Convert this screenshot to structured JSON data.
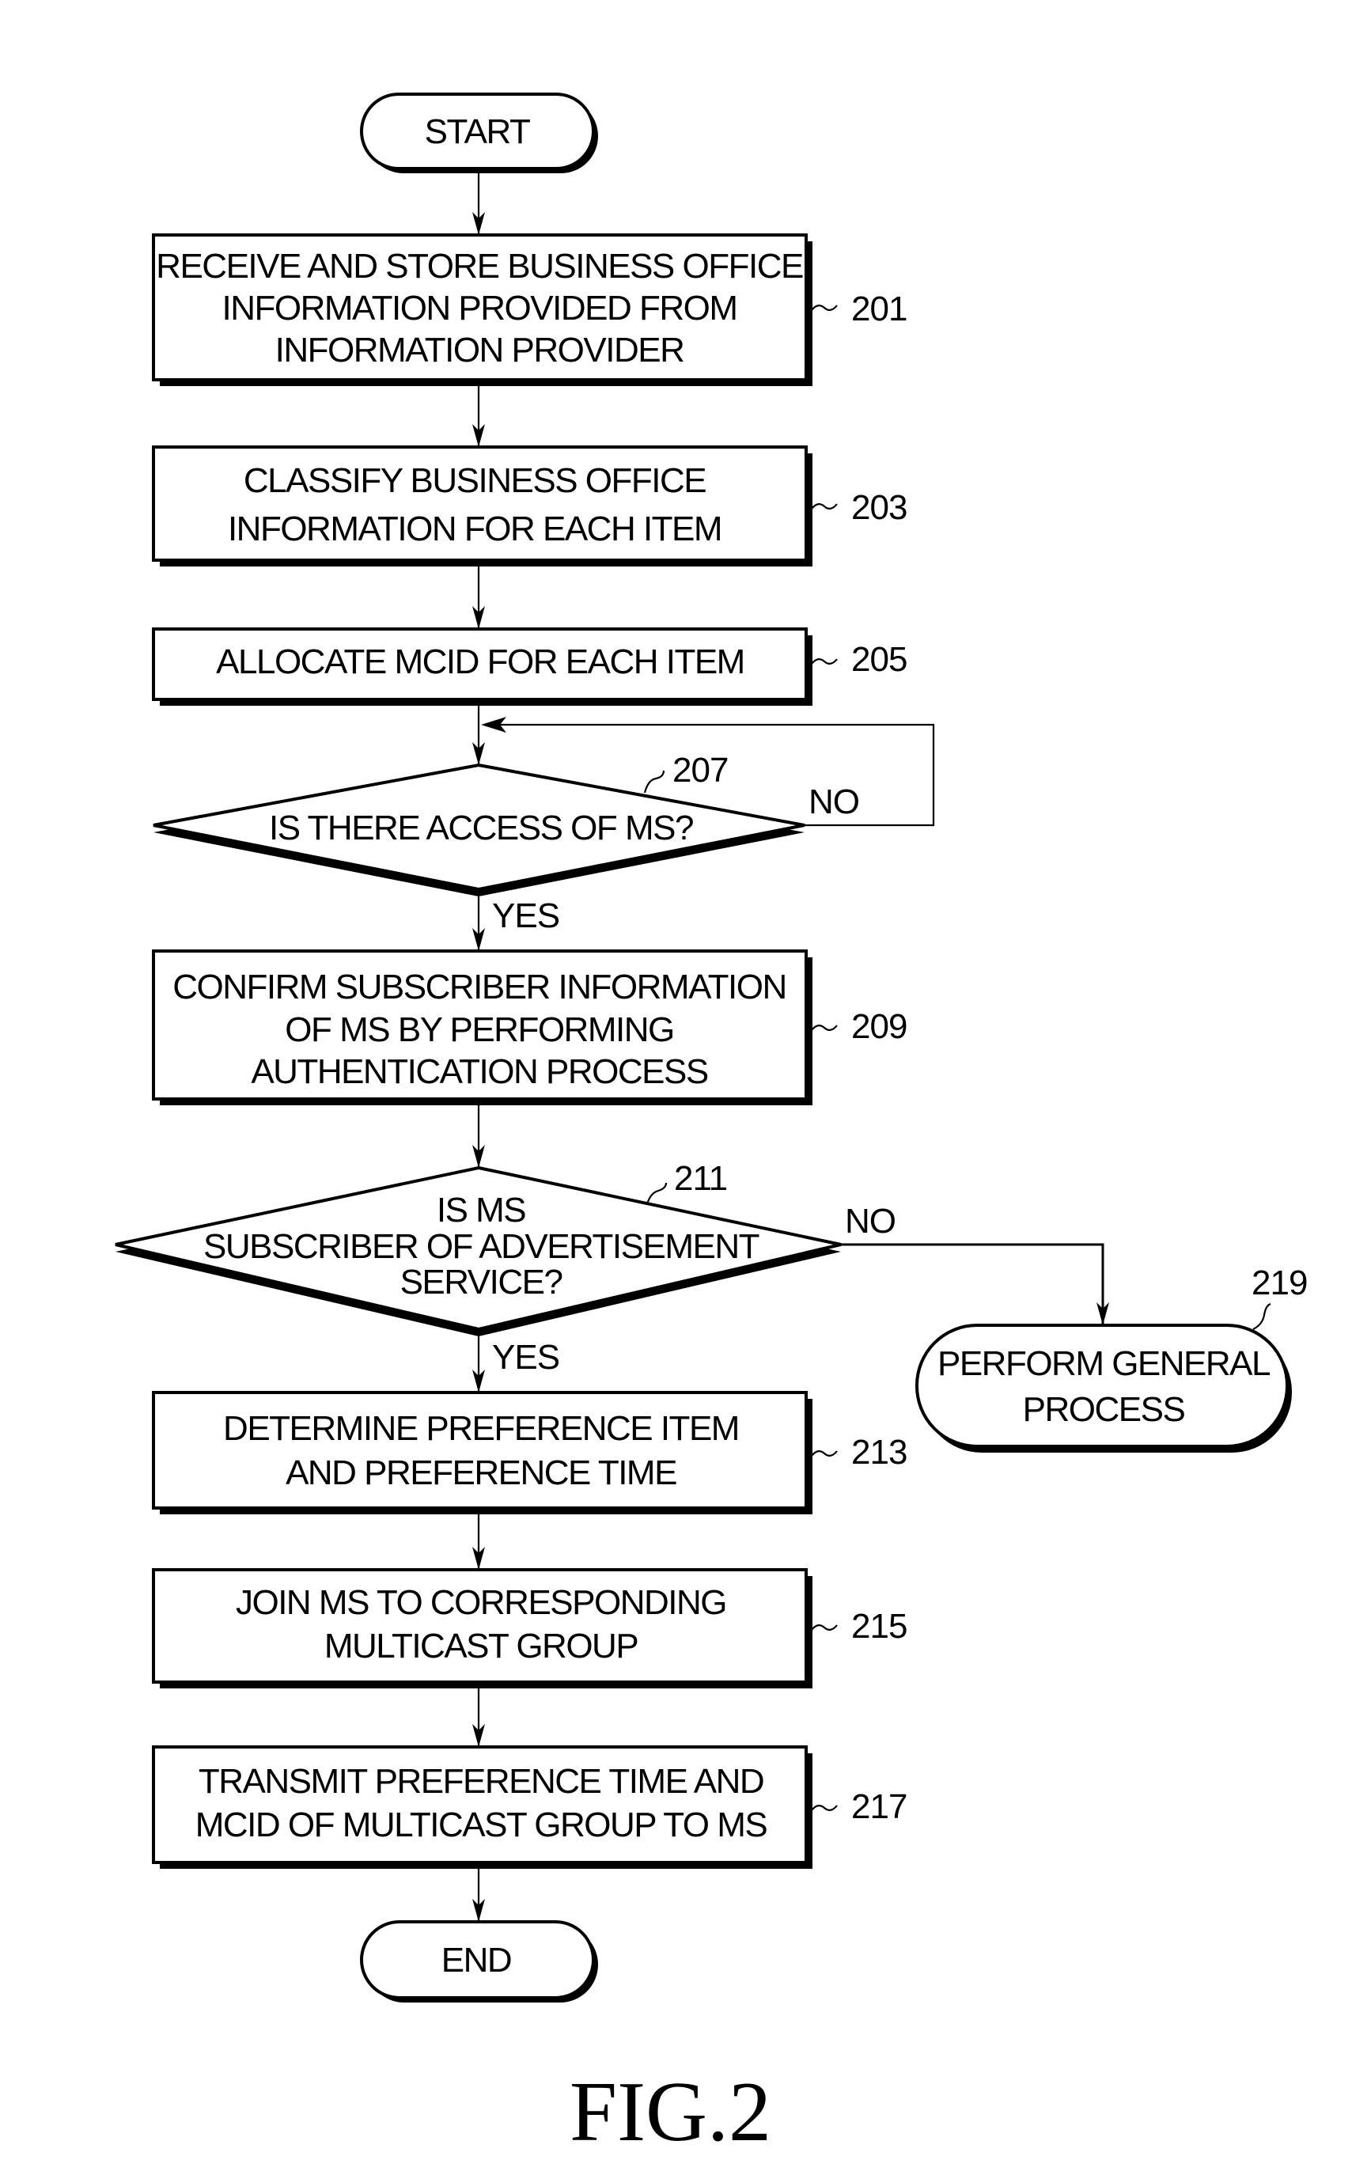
{
  "figure": {
    "caption": "FIG.2",
    "type": "flowchart"
  },
  "nodes": {
    "start": {
      "label": [
        "START"
      ]
    },
    "s201": {
      "ref": "201",
      "label": [
        "RECEIVE AND STORE BUSINESS OFFICE",
        "INFORMATION PROVIDED FROM",
        "INFORMATION PROVIDER"
      ]
    },
    "s203": {
      "ref": "203",
      "label": [
        "CLASSIFY BUSINESS OFFICE",
        "INFORMATION FOR EACH ITEM"
      ]
    },
    "s205": {
      "ref": "205",
      "label": [
        "ALLOCATE MCID FOR EACH ITEM"
      ]
    },
    "s207": {
      "ref": "207",
      "label": [
        "IS THERE ACCESS OF MS?"
      ],
      "yes": "YES",
      "no": "NO"
    },
    "s209": {
      "ref": "209",
      "label": [
        "CONFIRM SUBSCRIBER INFORMATION",
        "OF MS BY PERFORMING",
        "AUTHENTICATION PROCESS"
      ]
    },
    "s211": {
      "ref": "211",
      "label": [
        "IS MS",
        "SUBSCRIBER OF ADVERTISEMENT",
        "SERVICE?"
      ],
      "yes": "YES",
      "no": "NO"
    },
    "s213": {
      "ref": "213",
      "label": [
        "DETERMINE PREFERENCE ITEM",
        "AND PREFERENCE TIME"
      ]
    },
    "s215": {
      "ref": "215",
      "label": [
        "JOIN MS TO CORRESPONDING",
        "MULTICAST GROUP"
      ]
    },
    "s217": {
      "ref": "217",
      "label": [
        "TRANSMIT PREFERENCE TIME AND",
        "MCID OF MULTICAST GROUP TO MS"
      ]
    },
    "s219": {
      "ref": "219",
      "label": [
        "PERFORM GENERAL",
        "PROCESS"
      ]
    },
    "end": {
      "label": [
        "END"
      ]
    }
  }
}
